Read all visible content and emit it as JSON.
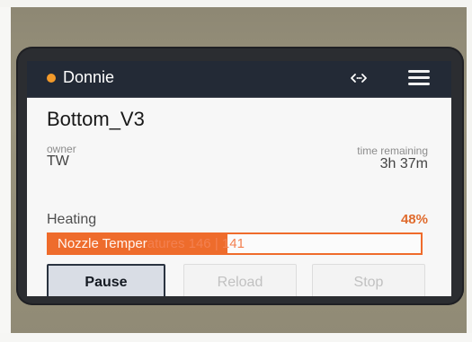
{
  "status": {
    "indicator_color": "#f39a2a"
  },
  "header": {
    "printer_name": "Donnie",
    "connection_icon": "network-link-icon",
    "menu_icon": "menu-icon"
  },
  "job": {
    "name": "Bottom_V3",
    "owner_label": "owner",
    "owner_value": "TW",
    "time_label": "time remaining",
    "time_value": "3h 37m"
  },
  "progress": {
    "phase_label": "Heating",
    "percent_text": "48%",
    "percent_value": 0.48,
    "details": "Nozzle Temperatures 146 | 141",
    "accent_color": "#ee6c2c"
  },
  "actions": {
    "pause_label": "Pause",
    "reload_label": "Reload",
    "stop_label": "Stop"
  }
}
